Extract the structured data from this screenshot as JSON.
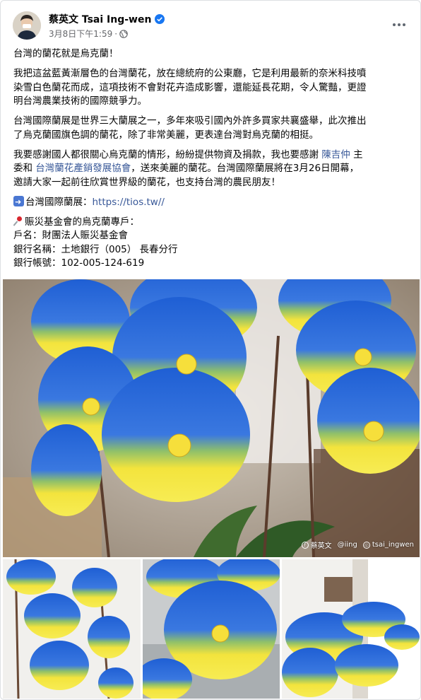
{
  "post": {
    "author": "蔡英文 Tsai Ing-wen",
    "timestamp": "3月8日下午1:59",
    "dot": "·",
    "verified_icon": "verified-badge-icon",
    "privacy_icon": "globe-icon",
    "more_icon": "more-options-icon"
  },
  "text": {
    "p1": "台灣的蘭花就是烏克蘭！",
    "p2_lines": [
      "我把這盆藍黃漸層色的台灣蘭花，放在總統府的公東廳，它是利用最新的奈米科技噴",
      "染雪白色蘭花而成，這項技術不會對花卉造成影響，還能延長花期，令人驚豔，更證",
      "明台灣農業技術的國際競爭力。"
    ],
    "p3_lines": [
      "台灣國際蘭展是世界三大蘭展之一，多年來吸引國內外許多買家共襄盛舉，此次推出",
      "了烏克蘭國旗色調的蘭花，除了非常美麗，更表達台灣對烏克蘭的相挺。"
    ],
    "p4_part1": "我要感謝國人都很關心烏克蘭的情形，紛紛提供物資及捐款，我也要感謝 ",
    "p4_link1": "陳吉仲",
    "p4_part2": " 主",
    "p4_line2_pre": "委和 ",
    "p4_link2": "台灣蘭花產銷發展協會",
    "p4_line2_post": "，送來美麗的蘭花。台灣國際蘭展將在3月26日開幕，",
    "p4_line3": "邀請大家一起前往欣賞世界級的蘭花，也支持台灣的農民朋友！",
    "p5_label": "台灣國際蘭展：",
    "p5_link": "https://tios.tw//",
    "p6_title": "賑災基金會的烏克蘭專戶：",
    "p6_name": "戶名：財團法人賑災基金會",
    "p6_bank": "銀行名稱：土地銀行（005） 長春分行",
    "p6_account": "銀行帳號：102-005-124-619"
  },
  "photos": {
    "main_watermark": [
      "蔡英文",
      "@iing",
      "tsai_ingwen"
    ]
  },
  "colors": {
    "link": "#385898",
    "blue_petal": "#2a66d6",
    "yellow_petal": "#f2e23a"
  }
}
